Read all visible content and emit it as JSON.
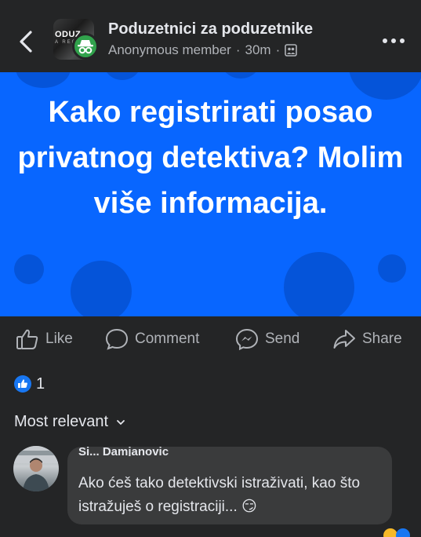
{
  "header": {
    "group_name": "Poduzetnici za poduzetnike",
    "author": "Anonymous member",
    "separator": "·",
    "time": "30m",
    "thumb_text": "ODUZ",
    "thumb_sub": "A REG"
  },
  "banner": {
    "text": "Kako registrirati posao privatnog detektiva?  Molim više informacija.",
    "background_color": "#0866ff"
  },
  "actions": {
    "like": "Like",
    "comment": "Comment",
    "send": "Send",
    "share": "Share"
  },
  "reactions": {
    "count": "1"
  },
  "comments": {
    "sort_label": "Most relevant",
    "items": [
      {
        "author": "Si... Damjanovic",
        "text": "Ako ćeš tako detektivski istraživati, kao što istražuješ o registraciji... 😏"
      }
    ]
  },
  "icons": {
    "back": "chevron-left-icon",
    "more": "more-horizontal-icon",
    "anonymous": "incognito-icon",
    "group": "group-icon",
    "like": "thumbs-up-icon",
    "comment": "comment-bubble-icon",
    "send": "messenger-icon",
    "share": "share-arrow-icon",
    "sort": "chevron-down-icon"
  }
}
